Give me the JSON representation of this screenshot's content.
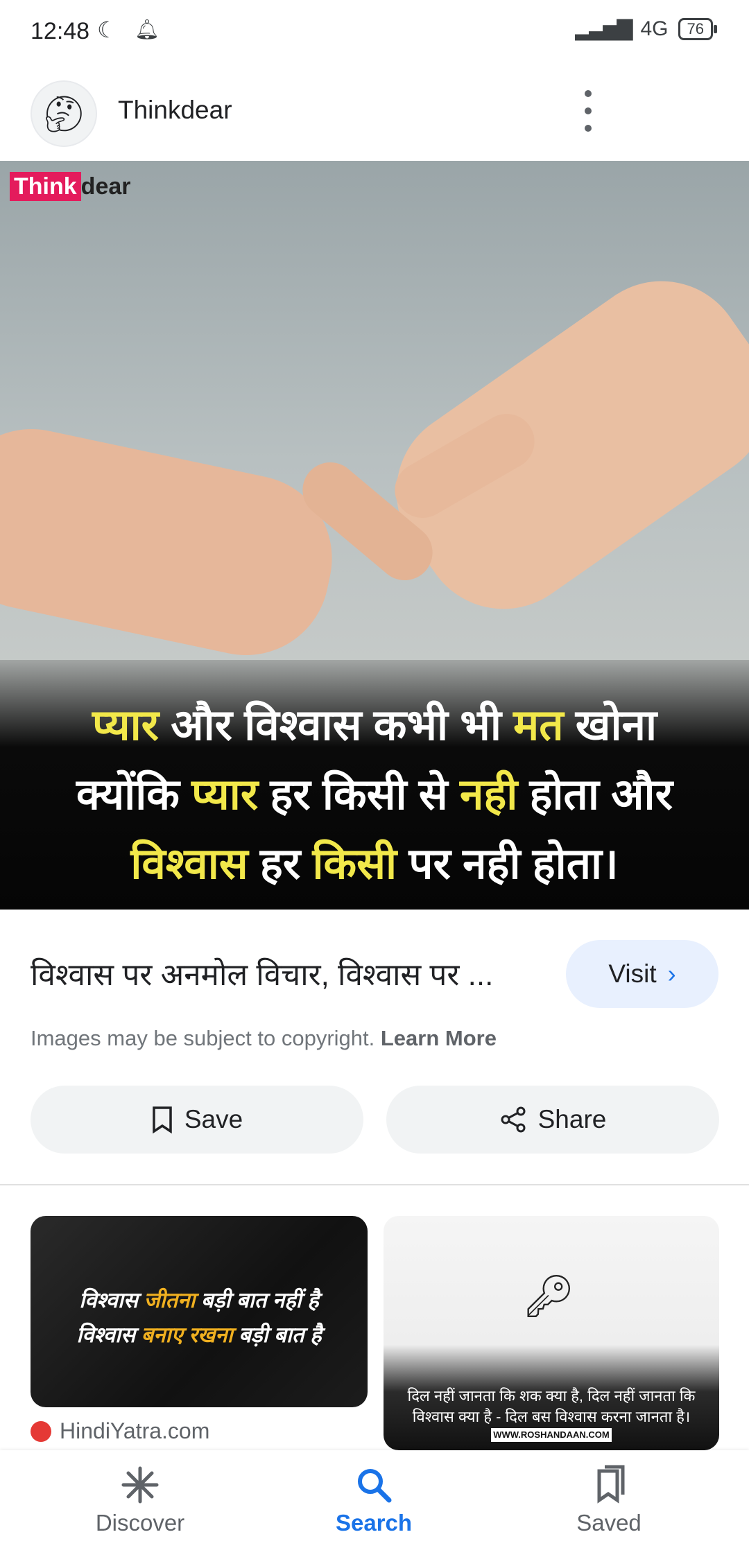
{
  "status_bar": {
    "time": "12:48",
    "network": "4G",
    "battery": "76"
  },
  "header": {
    "site_name": "Thinkdear",
    "avatar_icon": "thinking-face-icon"
  },
  "image": {
    "logo_think": "Think",
    "logo_dear": "dear",
    "quote_lines": [
      [
        "प्यार",
        " और विश्वास कभी भी ",
        "मत",
        " खोना"
      ],
      [
        "क्योंकि ",
        "प्यार",
        " हर किसी से ",
        "नही",
        " होता और"
      ],
      [
        "विश्वास",
        " हर ",
        "किसी",
        " पर नही होता।"
      ]
    ]
  },
  "result": {
    "title": "विश्वास पर अनमोल विचार, विश्वास पर ...",
    "visit_label": "Visit",
    "copyright_text": "Images may be subject to copyright.",
    "learn_more": "Learn More",
    "save_label": "Save",
    "share_label": "Share"
  },
  "related": {
    "card1_line1_a": "विश्वास ",
    "card1_line1_b": "जीतना",
    "card1_line1_c": " बड़ी बात नहीं है",
    "card1_line2_a": "विश्वास ",
    "card1_line2_b": "बनाए रखना",
    "card1_line2_c": " बड़ी बात है",
    "card1_source": "HindiYatra.com",
    "card2_line1": "दिल नहीं जानता कि शक क्या है, दिल नहीं जानता कि",
    "card2_line2": "विश्वास क्या है - दिल बस विश्वास करना जानता है।",
    "card2_url": "WWW.ROSHANDAAN.COM"
  },
  "bottom_nav": [
    {
      "label": "Discover",
      "icon": "asterisk-icon",
      "active": false
    },
    {
      "label": "Search",
      "icon": "search-icon",
      "active": true
    },
    {
      "label": "Saved",
      "icon": "bookmarks-icon",
      "active": false
    }
  ],
  "colors": {
    "accent": "#1a73e8",
    "visit_bg": "#e8f0fe",
    "pill_bg": "#f1f3f4",
    "quote_yellow": "#f2e84a"
  }
}
